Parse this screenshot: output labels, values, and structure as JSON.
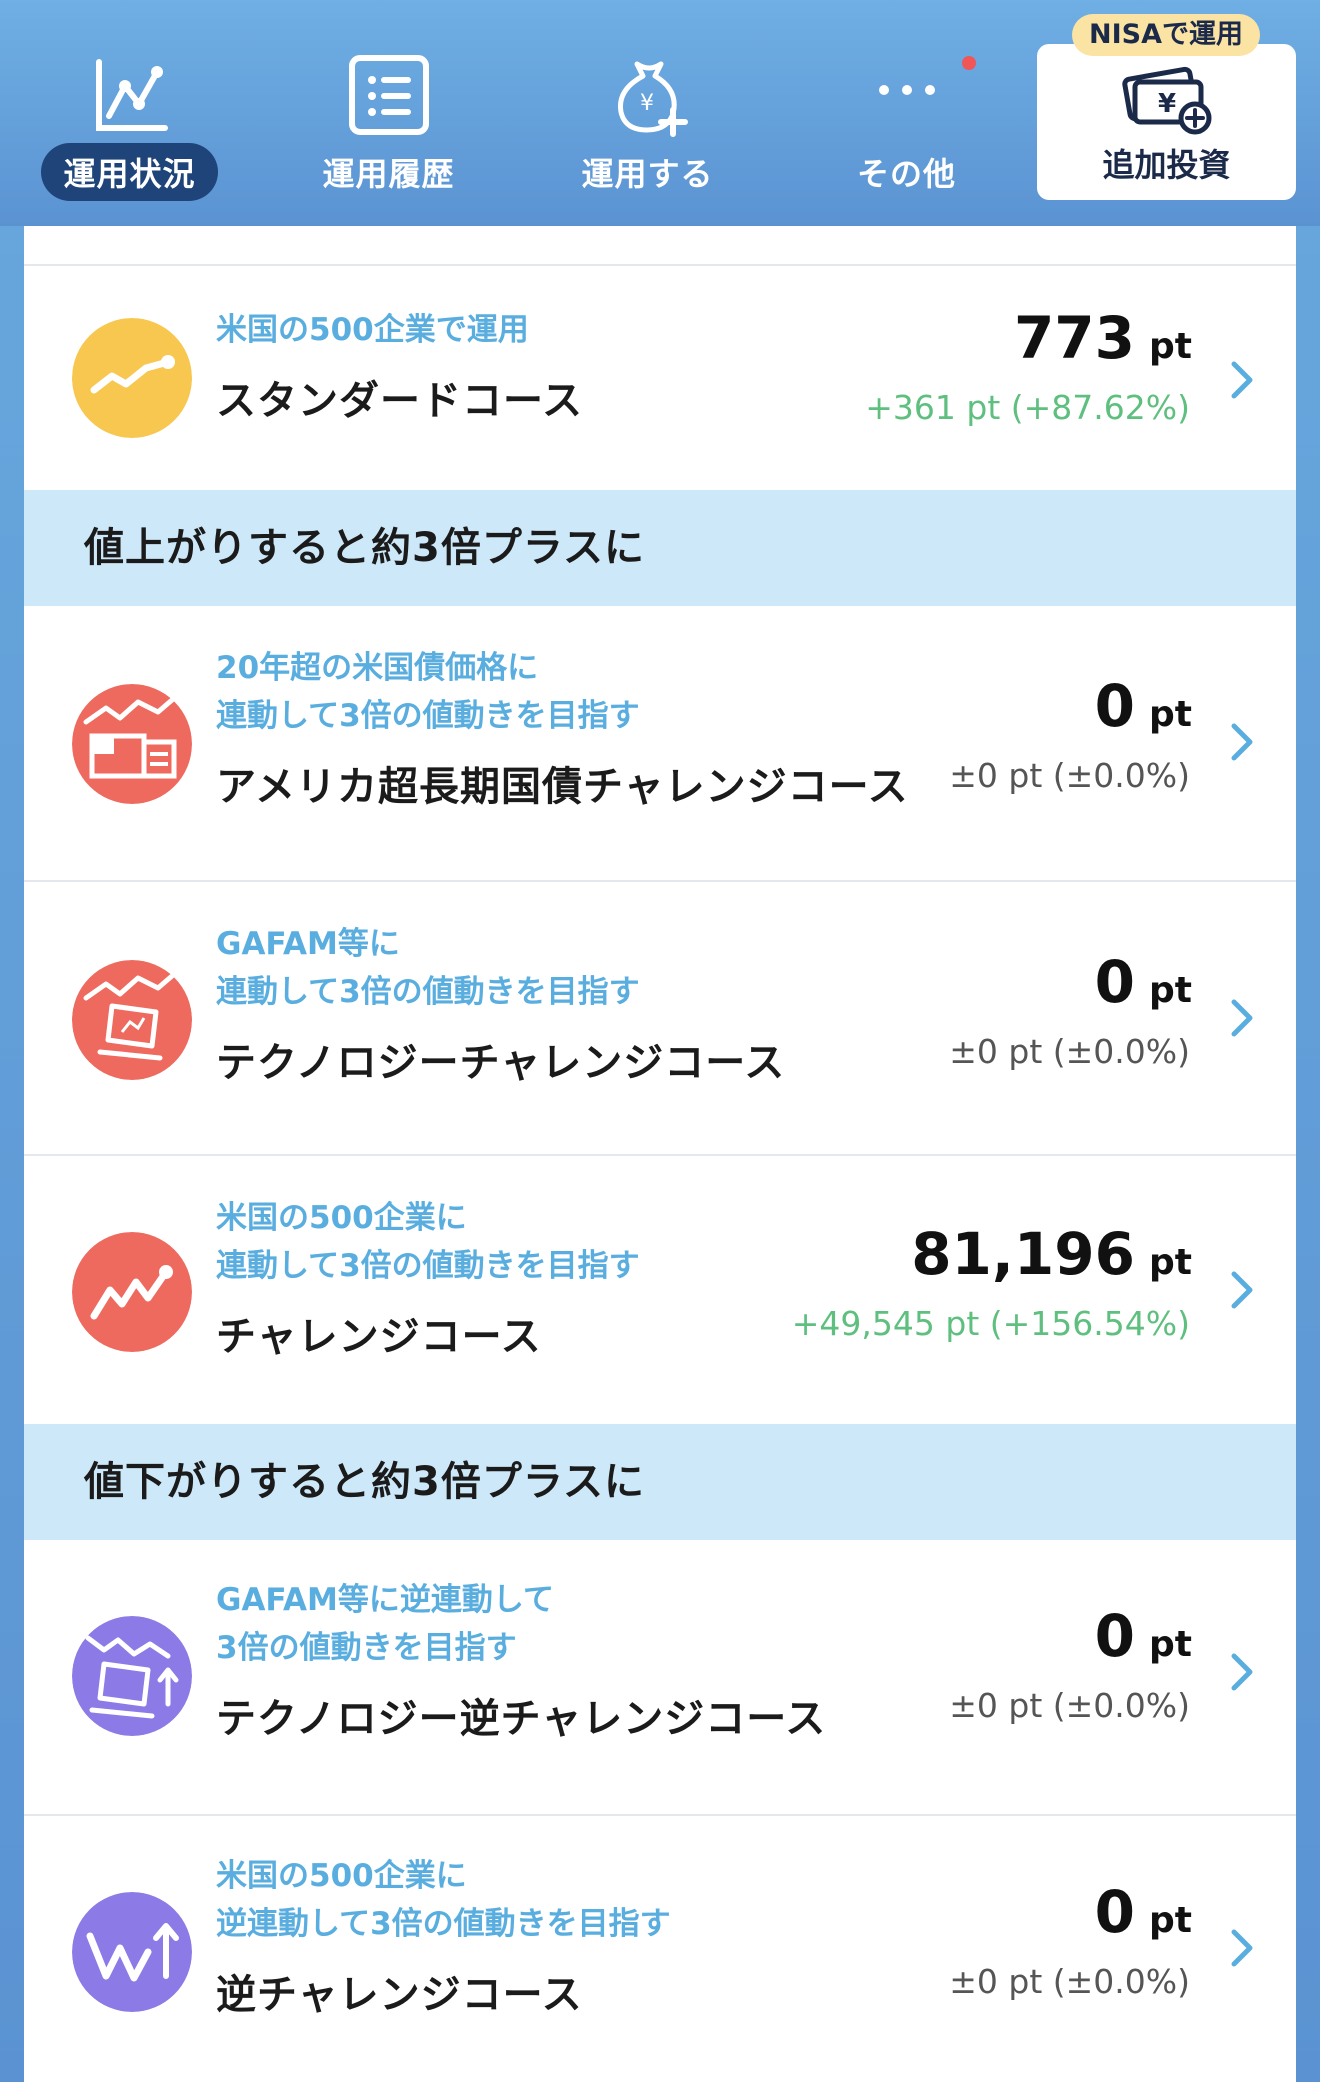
{
  "nav": {
    "items": [
      {
        "label": "運用状況",
        "icon": "line-chart-icon"
      },
      {
        "label": "運用履歴",
        "icon": "list-icon"
      },
      {
        "label": "運用する",
        "icon": "money-bag-add-icon"
      },
      {
        "label": "その他",
        "icon": "more-dots-icon"
      }
    ],
    "add_investment": {
      "badge": "NISAで運用",
      "label": "追加投資",
      "icon": "yen-bills-add-icon"
    }
  },
  "courses": {
    "standard": {
      "sub": "米国の500企業で運用",
      "name": "スタンダードコース",
      "value": "773",
      "unit": "pt",
      "change": "+361 pt (+87.62%)"
    },
    "us_bond": {
      "sub1": "20年超の米国債価格に",
      "sub2": "連動して3倍の値動きを目指す",
      "name": "アメリカ超長期国債チャレンジコース",
      "value": "0",
      "unit": "pt",
      "change": "±0 pt (±0.0%)"
    },
    "tech": {
      "sub1": "GAFAM等に",
      "sub2": "連動して3倍の値動きを目指す",
      "name": "テクノロジーチャレンジコース",
      "value": "0",
      "unit": "pt",
      "change": "±0 pt (±0.0%)"
    },
    "challenge": {
      "sub1": "米国の500企業に",
      "sub2": "連動して3倍の値動きを目指す",
      "name": "チャレンジコース",
      "value": "81,196",
      "unit": "pt",
      "change": "+49,545 pt (+156.54%)"
    },
    "tech_inverse": {
      "sub1": "GAFAM等に逆連動して",
      "sub2": "3倍の値動きを目指す",
      "name": "テクノロジー逆チャレンジコース",
      "value": "0",
      "unit": "pt",
      "change": "±0 pt (±0.0%)"
    },
    "inverse": {
      "sub1": "米国の500企業に",
      "sub2": "逆連動して3倍の値動きを目指す",
      "name": "逆チャレンジコース",
      "value": "0",
      "unit": "pt",
      "change": "±0 pt (±0.0%)"
    }
  },
  "sections": {
    "up": "値上がりすると約3倍プラスに",
    "down": "値下がりすると約3倍プラスに"
  },
  "colors": {
    "standard": "#f7c74f",
    "challenge": "#ee6a5f",
    "inverse": "#8c7ae6",
    "positive": "#5fbf7f",
    "accent": "#5aaedf"
  }
}
